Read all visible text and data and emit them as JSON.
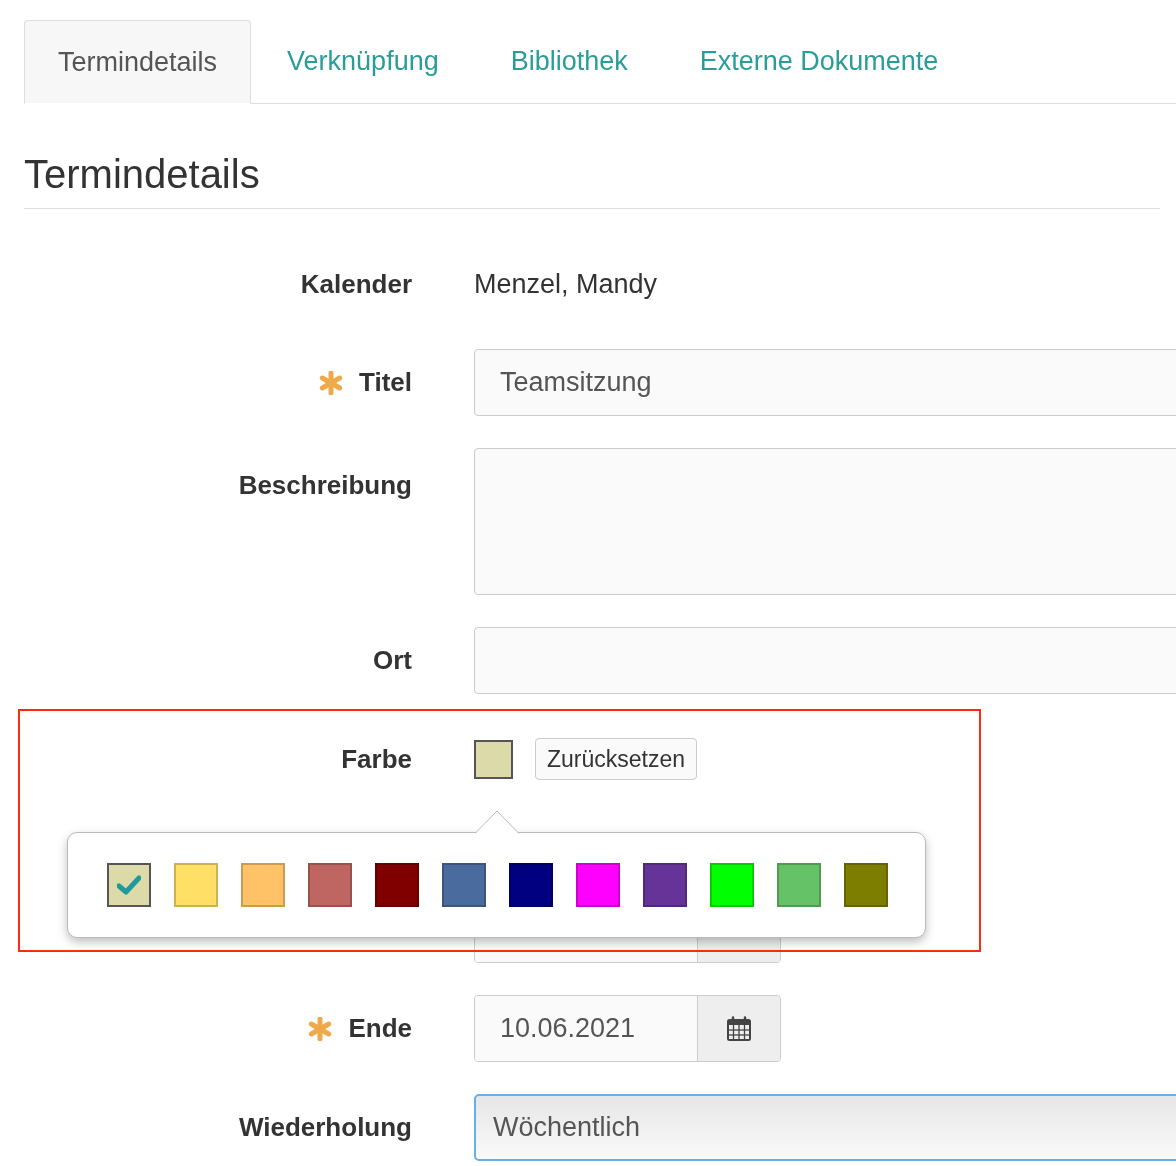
{
  "tabs": [
    {
      "label": "Termindetails",
      "selected": true
    },
    {
      "label": "Verknüpfung",
      "selected": false
    },
    {
      "label": "Bibliothek",
      "selected": false
    },
    {
      "label": "Externe Dokumente",
      "selected": false
    }
  ],
  "heading": "Termindetails",
  "fields": [
    {
      "kind": "static",
      "label": "Kalender",
      "value": "Menzel, Mandy",
      "required": false
    },
    {
      "kind": "text",
      "label": "Titel",
      "value": "Teamsitzung",
      "required": true
    },
    {
      "kind": "textarea",
      "label": "Beschreibung",
      "required": false
    },
    {
      "kind": "text",
      "label": "Ort",
      "required": false
    },
    {
      "kind": "color",
      "label": "Farbe",
      "color": "#dddaaa",
      "reset": "Zurücksetzen",
      "required": false
    },
    {
      "kind": "date"
    },
    {
      "kind": "date",
      "label": "Ende",
      "value": "10.06.2021",
      "required": true
    },
    {
      "kind": "select",
      "label": "Wiederholung",
      "value": "Wöchentlich",
      "required": false
    }
  ],
  "palette": [
    {
      "color": "#dddaaa",
      "selected": true
    },
    {
      "color": "#ffdf66",
      "selected": false
    },
    {
      "color": "#ffc266",
      "selected": false
    },
    {
      "color": "#c06662",
      "selected": false
    },
    {
      "color": "#800000",
      "selected": false
    },
    {
      "color": "#4a6b9d",
      "selected": false
    },
    {
      "color": "#000080",
      "selected": false
    },
    {
      "color": "#ff00ff",
      "selected": false
    },
    {
      "color": "#663399",
      "selected": false
    },
    {
      "color": "#00ff00",
      "selected": false
    },
    {
      "color": "#66c266",
      "selected": false
    },
    {
      "color": "#7d7d00",
      "selected": false
    }
  ]
}
